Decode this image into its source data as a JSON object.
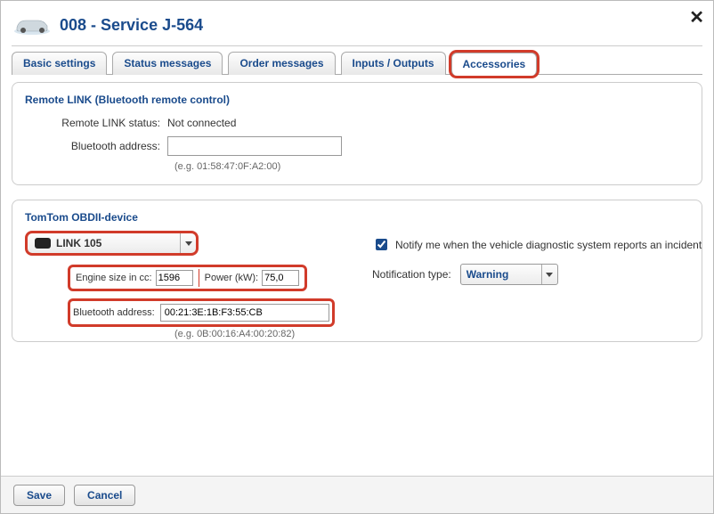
{
  "header": {
    "title": "008 - Service J-564"
  },
  "tabs": {
    "basic": "Basic settings",
    "status": "Status messages",
    "order": "Order messages",
    "io": "Inputs / Outputs",
    "accessories": "Accessories"
  },
  "remote_link": {
    "title": "Remote LINK (Bluetooth remote control)",
    "status_label": "Remote LINK status:",
    "status_value": "Not connected",
    "bt_label": "Bluetooth address:",
    "bt_value": "",
    "bt_hint": "(e.g. 01:58:47:0F:A2:00)"
  },
  "obd": {
    "title": "TomTom OBDII-device",
    "device": "LINK 105",
    "engine_label": "Engine size in cc:",
    "engine_value": "1596",
    "power_label": "Power (kW):",
    "power_value": "75,0",
    "bt_label": "Bluetooth address:",
    "bt_value": "00:21:3E:1B:F3:55:CB",
    "bt_hint": "(e.g. 0B:00:16:A4:00:20:82)",
    "notify_label": "Notify me when the vehicle diagnostic system reports an incident",
    "notify_checked": true,
    "ntype_label": "Notification type:",
    "ntype_value": "Warning"
  },
  "footer": {
    "save": "Save",
    "cancel": "Cancel"
  }
}
